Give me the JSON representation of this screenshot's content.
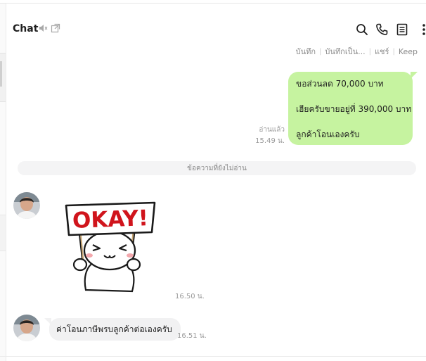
{
  "header": {
    "title": "Chat",
    "icons": [
      "speaker-muted-icon",
      "open-window-icon",
      "search-icon",
      "phone-icon",
      "notes-icon",
      "more-vertical-icon"
    ]
  },
  "subtabs": [
    "บันทึก",
    "บันทึกเป็น...",
    "แชร์",
    "Keep"
  ],
  "outgoing_message": {
    "lines": [
      "ขอส่วนลด 70,000 บาท",
      "เฮียครับขายอยู่ที่ 390,000 บาท",
      "ลูกค้าโอนเองครับ"
    ],
    "read_status": "อ่านแล้ว",
    "time": "15.49 น."
  },
  "unread_divider": "ข้อความที่ยังไม่อ่าน",
  "incoming_sticker": {
    "sign_text": "OKAY!",
    "time": "16.50 น."
  },
  "incoming_message": {
    "text": "ค่าโอนภาษีพรบลูกค้าต่อเองครับ",
    "time": "16.51 น."
  },
  "colors": {
    "outgoing_bubble": "#c6f3a0",
    "incoming_bubble": "#f1f1f2",
    "sticker_text": "#d0141c"
  }
}
